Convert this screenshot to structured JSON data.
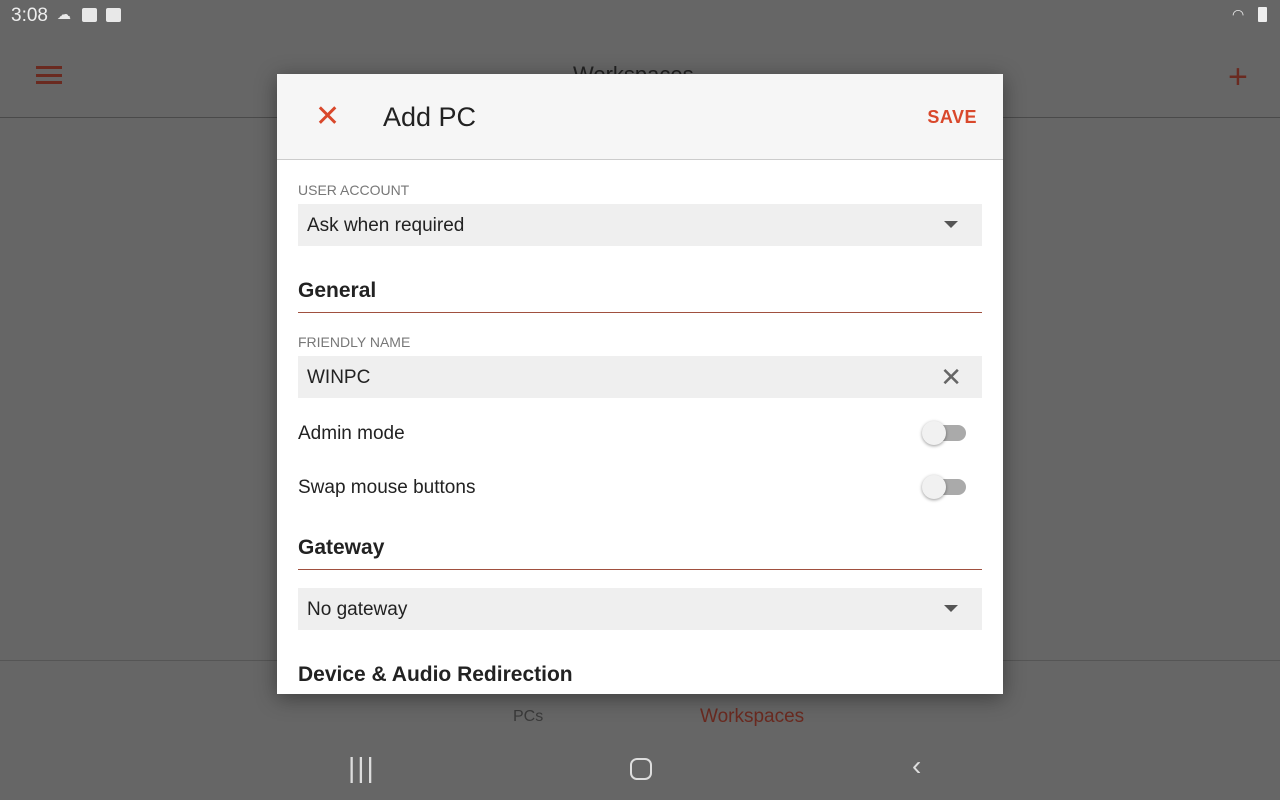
{
  "status_bar": {
    "time": "3:08"
  },
  "app_bar": {
    "title": "Workspaces"
  },
  "bottom_nav": {
    "tabs": [
      {
        "label": "PCs"
      },
      {
        "label": "Workspaces",
        "active": true
      }
    ]
  },
  "dialog": {
    "title": "Add PC",
    "save_label": "SAVE",
    "user_account": {
      "label": "USER ACCOUNT",
      "value": "Ask when required"
    },
    "general": {
      "heading": "General",
      "friendly_name_label": "FRIENDLY NAME",
      "friendly_name_value": "WINPC",
      "admin_mode": {
        "label": "Admin mode",
        "on": false
      },
      "swap_mouse": {
        "label": "Swap mouse buttons",
        "on": false
      }
    },
    "gateway": {
      "heading": "Gateway",
      "value": "No gateway"
    },
    "device_audio": {
      "heading": "Device & Audio Redirection"
    }
  },
  "colors": {
    "accent": "#d9482b",
    "overlay": "#666666"
  }
}
